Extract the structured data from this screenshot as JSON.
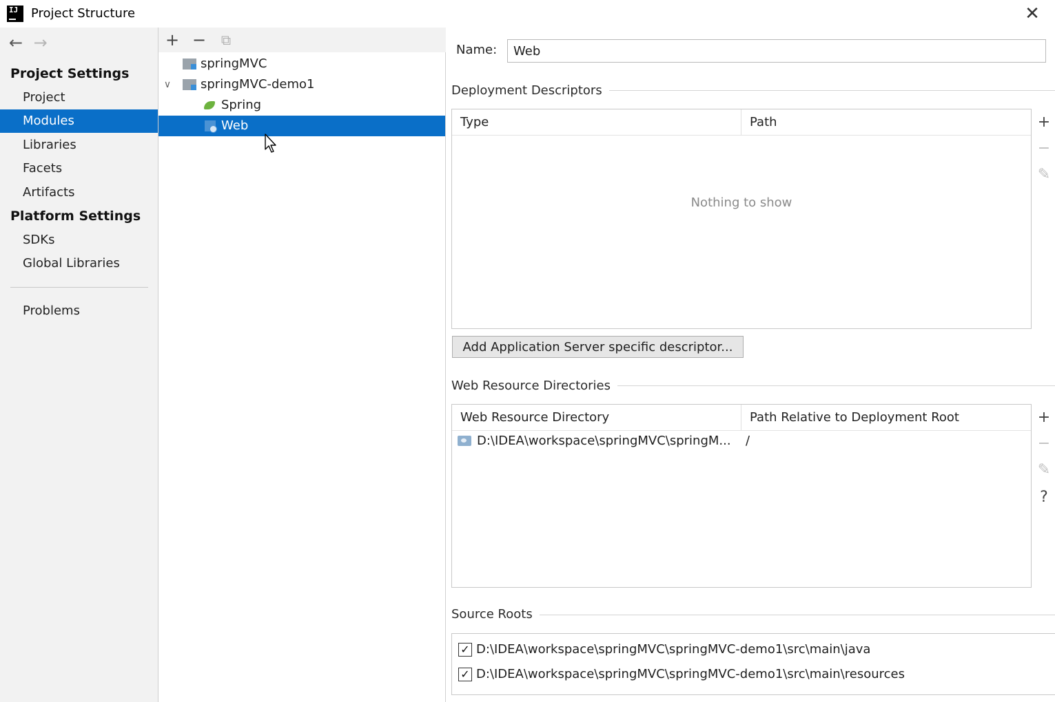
{
  "window": {
    "title": "Project Structure",
    "close_glyph": "✕"
  },
  "nav": {
    "back_glyph": "←",
    "forward_glyph": "→"
  },
  "sidebar": {
    "project_settings_label": "Project Settings",
    "platform_settings_label": "Platform Settings",
    "items": [
      {
        "label": "Project"
      },
      {
        "label": "Modules"
      },
      {
        "label": "Libraries"
      },
      {
        "label": "Facets"
      },
      {
        "label": "Artifacts"
      },
      {
        "label": "SDKs"
      },
      {
        "label": "Global Libraries"
      },
      {
        "label": "Problems"
      }
    ],
    "selected": "Modules"
  },
  "tree_toolbar": {
    "add_glyph": "+",
    "remove_glyph": "−",
    "copy_glyph": "⧉"
  },
  "tree": {
    "nodes": [
      {
        "label": "springMVC",
        "icon": "module-icon"
      },
      {
        "label": "springMVC-demo1",
        "icon": "module-icon",
        "expanded": true
      },
      {
        "label": "Spring",
        "icon": "spring-icon"
      },
      {
        "label": "Web",
        "icon": "web-icon",
        "selected": true
      }
    ],
    "chevron_glyph": "∨"
  },
  "content": {
    "name_label": "Name:",
    "name_value": "Web",
    "deployment_descriptors": {
      "title": "Deployment Descriptors",
      "columns": [
        "Type",
        "Path"
      ],
      "empty_text": "Nothing to show",
      "add_button": "Add Application Server specific descriptor..."
    },
    "web_resource_directories": {
      "title": "Web Resource Directories",
      "columns": [
        "Web Resource Directory",
        "Path Relative to Deployment Root"
      ],
      "rows": [
        {
          "directory": "D:\\IDEA\\workspace\\springMVC\\springM...",
          "relative_path": "/"
        }
      ]
    },
    "source_roots": {
      "title": "Source Roots",
      "items": [
        {
          "path": "D:\\IDEA\\workspace\\springMVC\\springMVC-demo1\\src\\main\\java",
          "checked": true
        },
        {
          "path": "D:\\IDEA\\workspace\\springMVC\\springMVC-demo1\\src\\main\\resources",
          "checked": true
        }
      ]
    },
    "side_tools": {
      "add_glyph": "+",
      "remove_glyph": "−",
      "edit_glyph": "✎",
      "help_glyph": "?"
    }
  },
  "check_glyph": "✓"
}
